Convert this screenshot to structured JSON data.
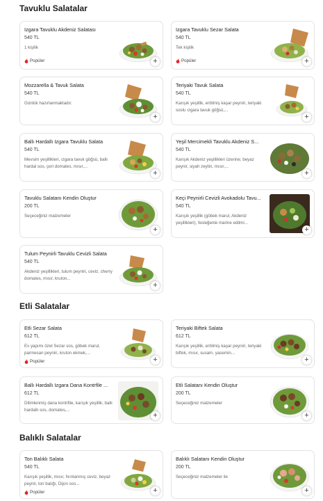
{
  "sections": [
    {
      "title": "Tavuklu Salatalar",
      "items": [
        {
          "name": "Izgara Tavuklu Akdeniz Salatası",
          "price": "540 TL",
          "desc": "1 kişilik",
          "badge": "Popüler"
        },
        {
          "name": "Izgara Tavuklu Sezar Salata",
          "price": "540 TL",
          "desc": "Tek kişilik",
          "badge": "Popüler"
        },
        {
          "name": "Mozzarella & Tavuk Salata",
          "price": "540 TL",
          "desc": "Günlük hazırlanmaktadır."
        },
        {
          "name": "Teriyaki Tavuk Salata",
          "price": "540 TL",
          "desc": "Karışık yeşillik, eritilmiş kaşar peyniri, teriyaki soslu ızgara tavuk göğsü,..."
        },
        {
          "name": "Ballı Hardallı Izgara Tavuklu Salata",
          "price": "540 TL",
          "desc": "Mevsim yeşillikleri, ızgara tavuk göğsü, ballı hardal sos, çeri domates, mısır,..."
        },
        {
          "name": "Yeşil Mercimekli Tavuklu Akdeniz S...",
          "price": "540 TL",
          "desc": "Karışık Akdeniz yeşillikleri üzerine; beyaz peynir, siyah zeytin, mısır,..."
        },
        {
          "name": "Tavuklu Salatanı Kendin Oluştur",
          "price": "200 TL",
          "desc": "Seçeceğiniz malzemeler"
        },
        {
          "name": "Keçi Peynirli Cevizli Avokadolu Tavu...",
          "price": "540 TL",
          "desc": "Karışık yeşillik (göbek marul, Akdeniz yeşillikleri), fesleğenle marine edilmi..."
        },
        {
          "name": "Tulum Peynirli Tavuklu Cevizli Salata",
          "price": "540 TL",
          "desc": "Akdeniz yeşillikleri, tulum peyniri, ceviz, cherry domates, mısır, kruton..."
        }
      ]
    },
    {
      "title": "Etli Salatalar",
      "items": [
        {
          "name": "Etli Sezar Salata",
          "price": "612 TL",
          "desc": "Ev yapımı özel Sezar sos, göbek marul, parmesan peyniri, kruton ekmek,...",
          "badge": "Popüler"
        },
        {
          "name": "Teriyaki Biftek Salata",
          "price": "612 TL",
          "desc": "Karışık yeşillik, eritilmiş kaşar peyniri, teriyaki biftek, mısır, susam, yasemin..."
        },
        {
          "name": "Ballı Hardallı Izgara Dana Kontrfile ...",
          "price": "612 TL",
          "desc": "Dilimlenmiş dana kontrfile, karışık yeşillik, ballı hardallı sos, domates,..."
        },
        {
          "name": "Etli Salatanı Kendin Oluştur",
          "price": "200 TL",
          "desc": "Seçeceğiniz malzemeler"
        }
      ]
    },
    {
      "title": "Balıklı Salatalar",
      "items": [
        {
          "name": "Ton Balıklı Salata",
          "price": "540 TL",
          "desc": "Karışık yeşillik, mısır, fırınlanmış ceviz, beyaz peynir, ton balığı, Dijon sos...",
          "badge": "Popüler"
        },
        {
          "name": "Balıklı Salatanı Kendin Oluştur",
          "price": "200 TL",
          "desc": "Seçeceğiniz malzemeler ile"
        }
      ]
    }
  ],
  "icons": {
    "add": "plus-icon",
    "popular": "flame-icon"
  },
  "colors": {
    "popular_flame": "#e8202a",
    "card_border": "#e3e3e3"
  }
}
